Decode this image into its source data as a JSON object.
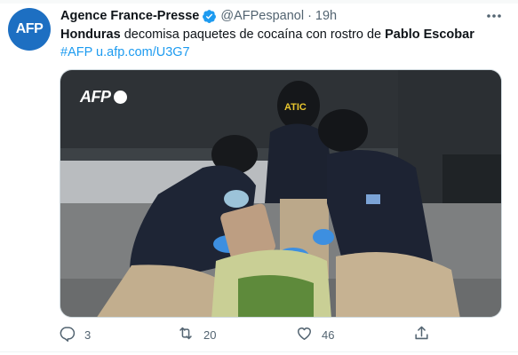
{
  "tweet": {
    "author_name": "Agence France-Presse",
    "author_handle": "@AFPespanol",
    "separator": "·",
    "timestamp": "19h",
    "avatar_text": "AFP",
    "text_parts": [
      {
        "text": "Honduras",
        "bold": true
      },
      {
        "text": " decomisa paquetes de cocaína con rostro de ",
        "bold": false
      },
      {
        "text": "Pablo Escobar",
        "bold": true
      }
    ],
    "hashtag": "#AFP",
    "link": "u.afp.com/U3G7",
    "media_watermark": "AFP",
    "media_badge_text": "ATIC"
  },
  "actions": {
    "replies": "3",
    "retweets": "20",
    "likes": "46"
  },
  "icons": {
    "verified": "verified-badge-icon",
    "more": "more-dots-icon",
    "reply": "reply-icon",
    "retweet": "retweet-icon",
    "like": "heart-icon",
    "share": "share-icon"
  },
  "colors": {
    "link": "#1d9bf0",
    "secondary_text": "#536471",
    "verified": "#1d9bf0",
    "avatar_bg": "#1d6fc2"
  }
}
